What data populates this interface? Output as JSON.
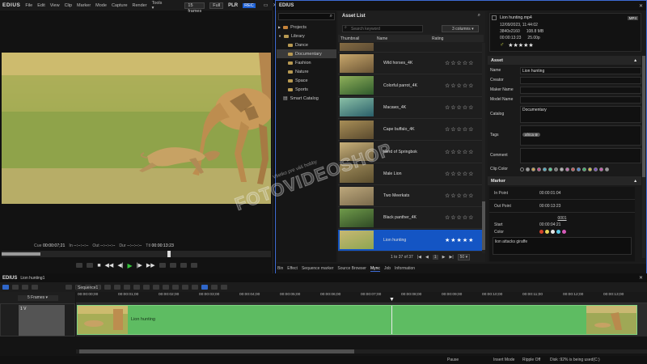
{
  "player": {
    "app_name": "EDIUS",
    "menu": [
      "File",
      "Edit",
      "View",
      "Clip",
      "Marker",
      "Mode",
      "Capture",
      "Render",
      "Tools"
    ],
    "tools_caret": "▾",
    "frames_select": "15 frames",
    "quality_select": "Full",
    "plr_label": "PLR",
    "rec_label": "REC",
    "cue_label": "Cue",
    "cue_value": "00:00:07;21",
    "in_label": "In",
    "in_value": "--:--:--:--",
    "out_label": "Out",
    "out_value": "--:--:--:--",
    "dur_label": "Dur",
    "dur_value": "--:--:--:--",
    "ttl_label": "Ttl",
    "ttl_value": "00:00:13:23"
  },
  "asset_window": {
    "title": "EDIUS",
    "tree": [
      {
        "label": "Projects",
        "level": 0,
        "arrow": "▶"
      },
      {
        "label": "Library",
        "level": 0,
        "arrow": "▼"
      },
      {
        "label": "Dance",
        "level": 1
      },
      {
        "label": "Documentary",
        "level": 1,
        "selected": true
      },
      {
        "label": "Fashion",
        "level": 1
      },
      {
        "label": "Nature",
        "level": 1
      },
      {
        "label": "Space",
        "level": 1
      },
      {
        "label": "Sports",
        "level": 1
      },
      {
        "label": "Smart Catalog",
        "level": 0
      }
    ],
    "list_title": "Asset List",
    "search_placeholder": "Search keyword",
    "columns_select": "3 columns",
    "headers": {
      "thumbnail": "Thumbnail",
      "name": "Name",
      "rating": "Rating"
    },
    "assets": [
      {
        "name": "",
        "stars": "☆☆☆☆☆",
        "colors": [
          "#5b4a33",
          "#9a7d4c"
        ]
      },
      {
        "name": "Wild horses_4K",
        "stars": "☆☆☆☆☆",
        "colors": [
          "#6b5536",
          "#c8a76b"
        ]
      },
      {
        "name": "Colorful parrot_4K",
        "stars": "☆☆☆☆☆",
        "colors": [
          "#2f5a2c",
          "#8fb05a"
        ]
      },
      {
        "name": "Macaws_4K",
        "stars": "☆☆☆☆☆",
        "colors": [
          "#2a5f6a",
          "#8ac0a6"
        ]
      },
      {
        "name": "Cape buffalo_4K",
        "stars": "☆☆☆☆☆",
        "colors": [
          "#5a4a2e",
          "#a88e57"
        ]
      },
      {
        "name": "Herd of Springbok",
        "stars": "☆☆☆☆☆",
        "colors": [
          "#6d5e3d",
          "#c8b07a"
        ]
      },
      {
        "name": "Male Lion",
        "stars": "☆☆☆☆☆",
        "colors": [
          "#5c4e2e",
          "#9e8b5a"
        ]
      },
      {
        "name": "Two Meerkats",
        "stars": "☆☆☆☆☆",
        "colors": [
          "#7a6a4c",
          "#bda87c"
        ]
      },
      {
        "name": "Black panther_4K",
        "stars": "☆☆☆☆☆",
        "colors": [
          "#2f4a25",
          "#6f9a4a"
        ]
      },
      {
        "name": "Lion hunting",
        "stars": "★★★★★",
        "colors": [
          "#8ea551",
          "#c7b873"
        ],
        "selected": true
      }
    ],
    "pagination": {
      "summary": "1 to 37 of 37",
      "first": "|◀",
      "prev": "◀",
      "page": "1",
      "next": "▶",
      "last": "▶|",
      "per_page": "50"
    },
    "details": {
      "filename": "Lion hunting.mp4",
      "badge": "MP4",
      "date": "12/09/2023, 11:44:02",
      "resolution": "3840x2160",
      "size": "108.8 MB",
      "duration": "00:00:13:23",
      "fps": "25.00p",
      "gender_icon": "♂",
      "stars": "★★★★★"
    },
    "asset_section": "Asset",
    "fields": {
      "name_label": "Name",
      "name_value": "Lion hunting",
      "creator_label": "Creator",
      "creator_value": "",
      "maker_label": "Maker Name",
      "maker_value": "",
      "model_label": "Model Name",
      "model_value": "",
      "catalog_label": "Catalog",
      "catalog_value": "Documentary",
      "tags_label": "Tags",
      "tag_chip": "africa",
      "comment_label": "Comment",
      "comment_value": "",
      "clip_color_label": "Clip Color"
    },
    "clip_colors": [
      "#1a1a1a",
      "#9a9a9a",
      "#d1a24a",
      "#c84f8a",
      "#4fb0c8",
      "#4fd29a",
      "#7a7a7a",
      "#b5b5b5",
      "#c76fb2",
      "#c85b5b",
      "#4c86d6",
      "#3ab56b",
      "#d4c040",
      "#7a4fc8",
      "#c85ab0",
      "#9a9a9a"
    ],
    "marker_section": "Marker",
    "marker": {
      "in_label": "In Point",
      "in_value": "00:00:01:04",
      "out_label": "Out Point",
      "out_value": "00:00:13:23",
      "id": "0001",
      "start_label": "Start",
      "start_value": "00:00:04:21",
      "color_label": "Color",
      "marker_colors": [
        "#d6452b",
        "#e8d45a",
        "#e6e6e6",
        "#5ac8e6",
        "#d65ab8"
      ],
      "comment": "lion attacks giraffe"
    },
    "tabs": [
      "Bin",
      "Effect",
      "Sequence marker",
      "Source Browser",
      "Mync",
      "Job",
      "Information"
    ]
  },
  "timeline": {
    "app_name": "EDIUS",
    "project": "Lion hunting1",
    "sequence_tab": "Sequence1",
    "frames_select": "5 Frames",
    "track_label": "1 V",
    "ruler": [
      "00:00:00;00",
      "00:00:01;00",
      "00:00:02;00",
      "00:00:03;00",
      "00:00:04;00",
      "00:00:05;00",
      "00:00:06;00",
      "00:00:07;00",
      "00:00:08;00",
      "00:00:09;00",
      "00:00:10;00",
      "00:00:11;00",
      "00:00:12;00",
      "00:00:13;00"
    ],
    "clip_label": "Lion hunting",
    "status": {
      "pause": "Pause",
      "insert": "Insert Mode",
      "ripple": "Ripple Off",
      "disk": "Disk :92% is being used(C:)"
    }
  },
  "watermark": {
    "main": "FOTOVIDEOSHOP",
    "sub": "Všetko pre váš hobby"
  }
}
